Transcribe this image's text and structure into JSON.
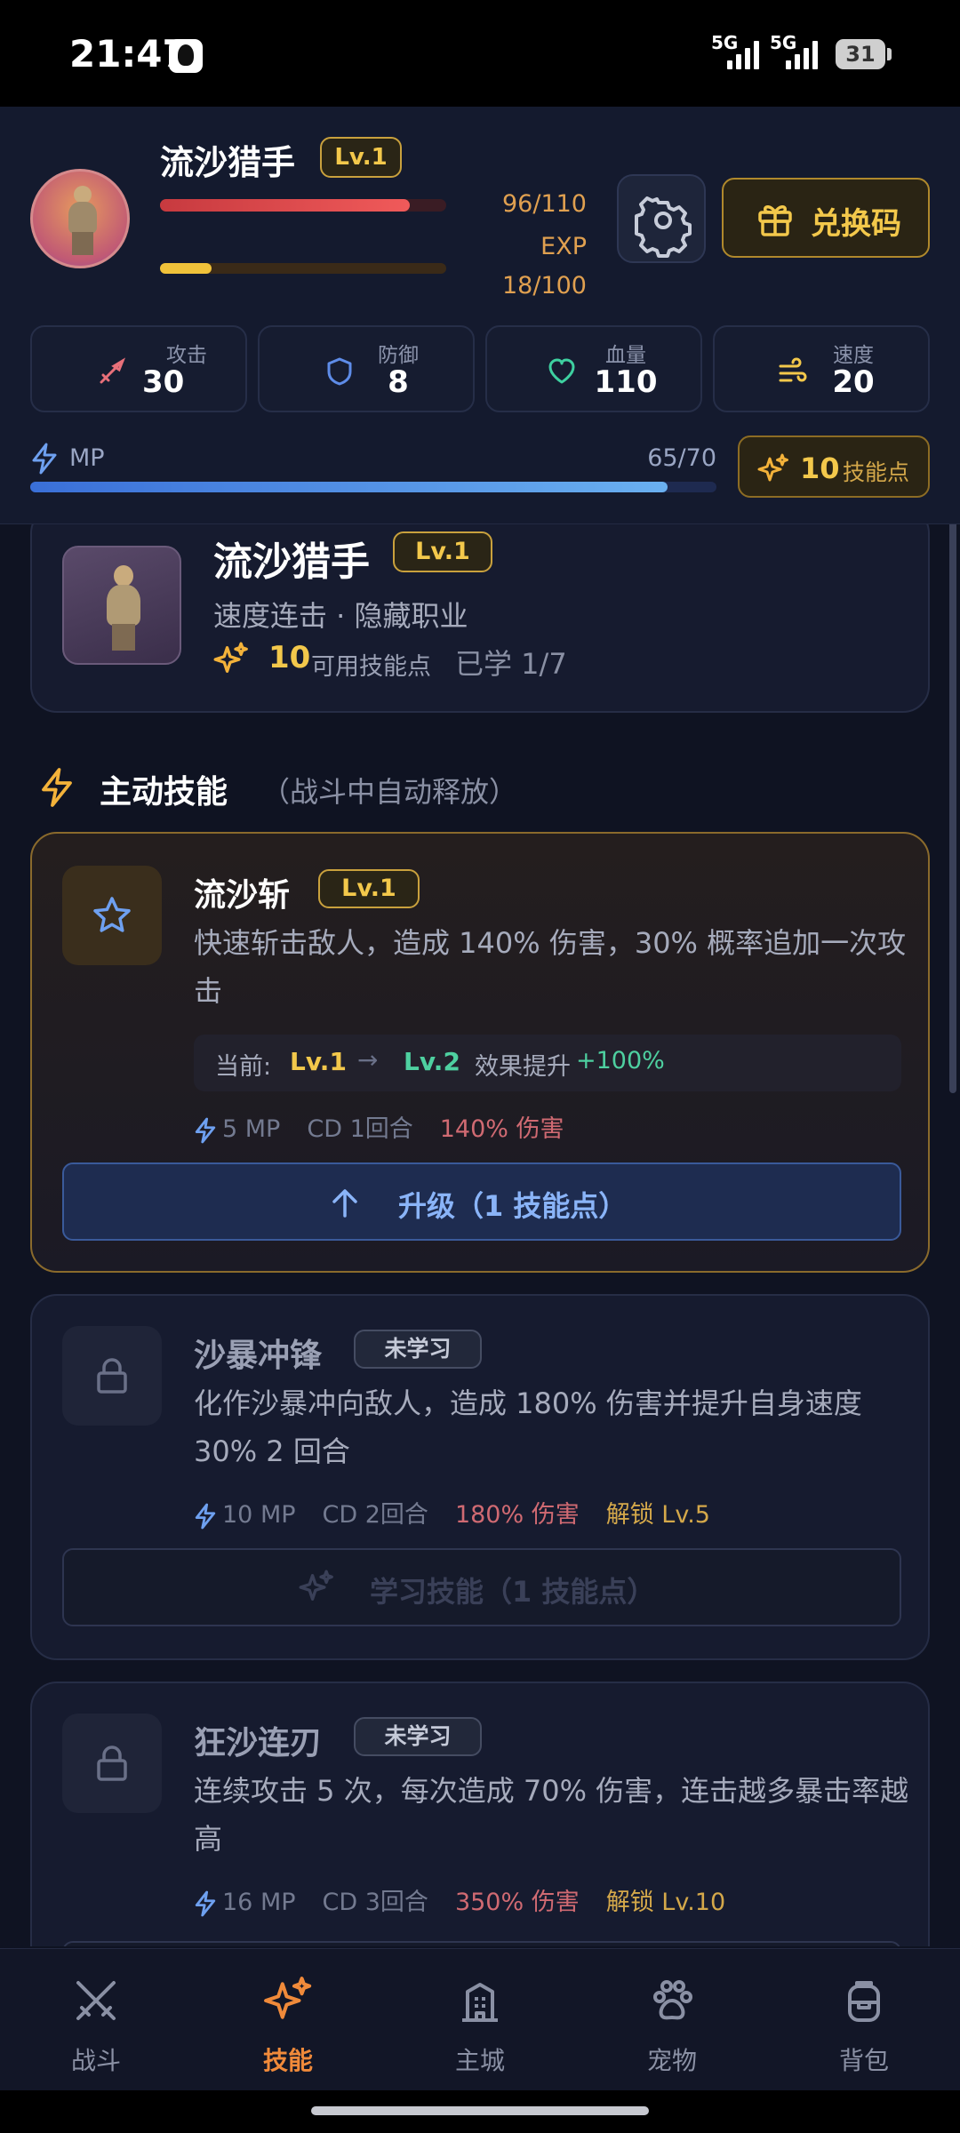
{
  "status_bar": {
    "time": "21:47",
    "sig1": "5G",
    "sig2": "5G",
    "battery": "31"
  },
  "player": {
    "name": "流沙猎手",
    "level": "Lv.1",
    "hp_text": "96/110",
    "hp_fraction": 0.873,
    "exp_label": "EXP",
    "exp_text": "18/100",
    "exp_fraction": 0.18
  },
  "buttons": {
    "redeem": "兑换码"
  },
  "stats": [
    {
      "label": "攻击",
      "value": "30"
    },
    {
      "label": "防御",
      "value": "8"
    },
    {
      "label": "血量",
      "value": "110"
    },
    {
      "label": "速度",
      "value": "20"
    }
  ],
  "mp": {
    "label": "MP",
    "text": "65/70",
    "fraction": 0.929
  },
  "skill_points_button": {
    "count": "10",
    "label": "技能点"
  },
  "class_card": {
    "name": "流沙猎手",
    "level": "Lv.1",
    "subtitle": "速度连击 · 隐藏职业",
    "points": "10",
    "points_label": "可用技能点",
    "learned": "已学 1/7"
  },
  "section": {
    "title": "主动技能",
    "subtitle": "（战斗中自动释放）"
  },
  "skills": [
    {
      "name": "流沙斩",
      "badge": "Lv.1",
      "desc": "快速斩击敌人，造成 140% 伤害，30% 概率追加一次攻击",
      "upgrade": {
        "current_label": "当前:",
        "from": "Lv.1",
        "arrow": "→",
        "to": "Lv.2",
        "effect_label": "效果提升",
        "effect": "+100%"
      },
      "mp": "5 MP",
      "cd": "CD 1回合",
      "dmg": "140% 伤害",
      "action": "升级（1 技能点）"
    },
    {
      "name": "沙暴冲锋",
      "badge": "未学习",
      "desc": "化作沙暴冲向敌人，造成 180% 伤害并提升自身速度 30% 2 回合",
      "mp": "10 MP",
      "cd": "CD 2回合",
      "dmg": "180% 伤害",
      "unlock": "解锁 Lv.5",
      "action": "学习技能（1 技能点）"
    },
    {
      "name": "狂沙连刃",
      "badge": "未学习",
      "desc": "连续攻击 5 次，每次造成 70% 伤害，连击越多暴击率越高",
      "mp": "16 MP",
      "cd": "CD 3回合",
      "dmg": "350% 伤害",
      "unlock": "解锁 Lv.10"
    }
  ],
  "nav": [
    {
      "label": "战斗",
      "icon": "swords-icon"
    },
    {
      "label": "技能",
      "icon": "sparkles-icon",
      "active": true
    },
    {
      "label": "主城",
      "icon": "building-icon"
    },
    {
      "label": "宠物",
      "icon": "paw-icon"
    },
    {
      "label": "背包",
      "icon": "backpack-icon"
    }
  ],
  "colors": {
    "accent_gold": "#f3c84b",
    "accent_orange": "#f08a3a",
    "hp_red": "#f05a5a",
    "mp_blue": "#4a8ee8",
    "bg": "#0f1322"
  }
}
